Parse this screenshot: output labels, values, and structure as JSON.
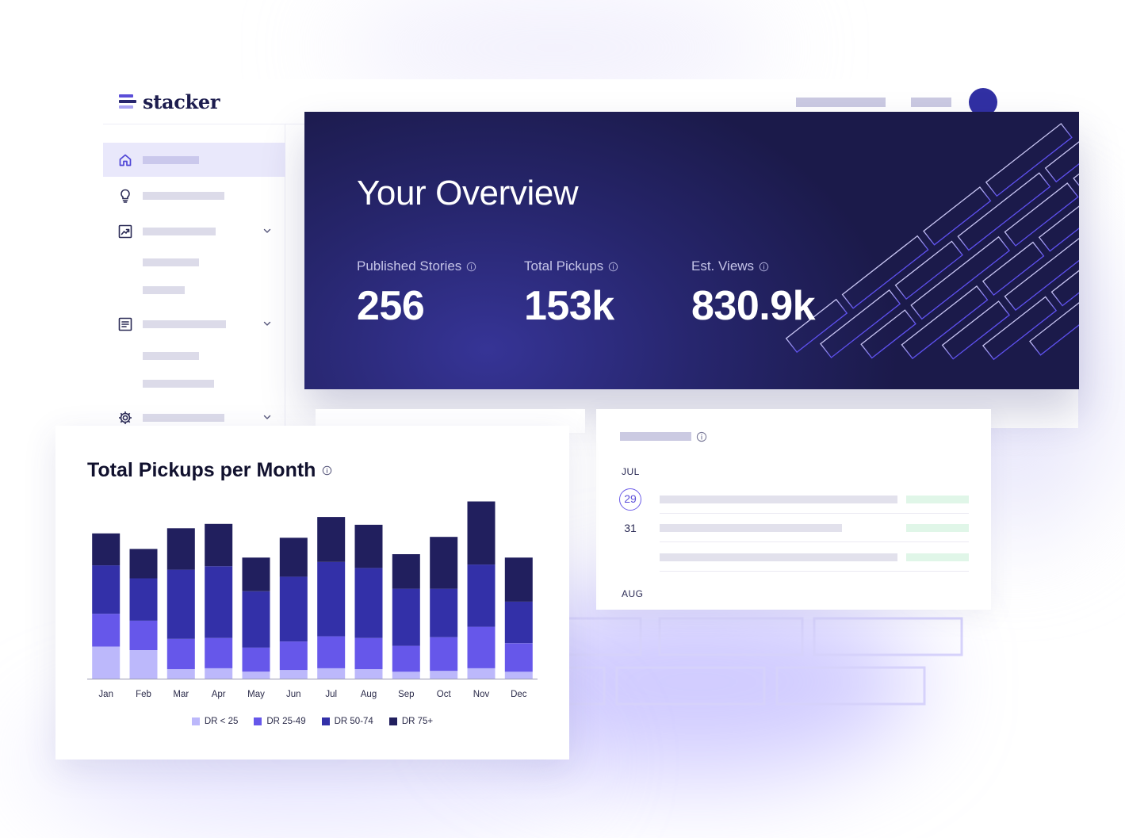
{
  "brand": {
    "name": "stacker"
  },
  "overview": {
    "title": "Your Overview",
    "stats": [
      {
        "label": "Published Stories",
        "value": "256"
      },
      {
        "label": "Total Pickups",
        "value": "153k"
      },
      {
        "label": "Est. Views",
        "value": "830.9k"
      }
    ]
  },
  "sidebar": {
    "icons": [
      "home-icon",
      "lightbulb-icon",
      "trending-chart-icon",
      "document-icon",
      "gear-icon"
    ]
  },
  "pipeline": {
    "months": [
      "JUL",
      "AUG"
    ],
    "days": [
      "29",
      "31"
    ]
  },
  "colors": {
    "navy": "#1b1a4a",
    "accent": "#5b4ed8",
    "series": [
      "#bcb8fb",
      "#6657ea",
      "#3330a8",
      "#211f5e"
    ]
  },
  "chart_data": {
    "type": "bar",
    "stacked": true,
    "title": "Total Pickups per Month",
    "categories": [
      "Jan",
      "Feb",
      "Mar",
      "Apr",
      "May",
      "Jun",
      "Jul",
      "Aug",
      "Sep",
      "Oct",
      "Nov",
      "Dec"
    ],
    "ylim": [
      0,
      210
    ],
    "series": [
      {
        "name": "DR < 25",
        "values": [
          37,
          33,
          11,
          12,
          8,
          10,
          12,
          11,
          8,
          9,
          12,
          8
        ]
      },
      {
        "name": "DR 25-49",
        "values": [
          38,
          34,
          35,
          35,
          28,
          33,
          37,
          36,
          30,
          39,
          48,
          33
        ]
      },
      {
        "name": "DR 50-74",
        "values": [
          56,
          49,
          80,
          83,
          65,
          75,
          86,
          81,
          66,
          56,
          72,
          48
        ]
      },
      {
        "name": "DR 75+",
        "values": [
          37,
          34,
          48,
          49,
          39,
          45,
          52,
          50,
          40,
          60,
          73,
          51
        ]
      }
    ],
    "legend_position": "bottom",
    "grid": false
  }
}
